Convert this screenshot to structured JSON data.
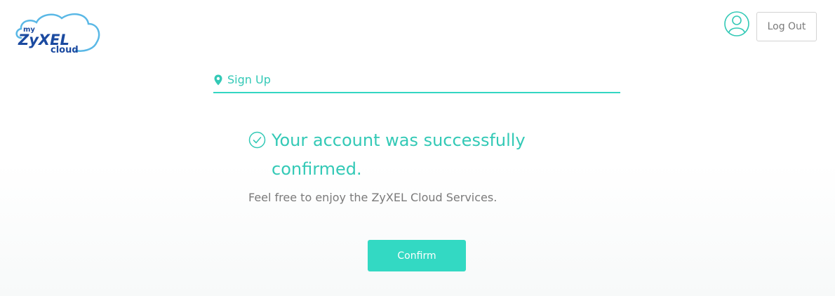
{
  "brand": {
    "logo_prefix": "my",
    "logo_name": "ZyXEL",
    "logo_suffix": "cloud",
    "primary_color": "#33c9b6",
    "logo_blue": "#1b4aa0",
    "cloud_outline": "#5ab8e6"
  },
  "header": {
    "user_icon": "user-icon",
    "logout_label": "Log Out"
  },
  "section": {
    "icon": "map-pin-icon",
    "title": "Sign Up"
  },
  "message": {
    "icon": "check-circle-icon",
    "headline": "Your account was successfully confirmed.",
    "subtext": "Feel free to enjoy the ZyXEL Cloud Services."
  },
  "actions": {
    "confirm_label": "Confirm"
  }
}
